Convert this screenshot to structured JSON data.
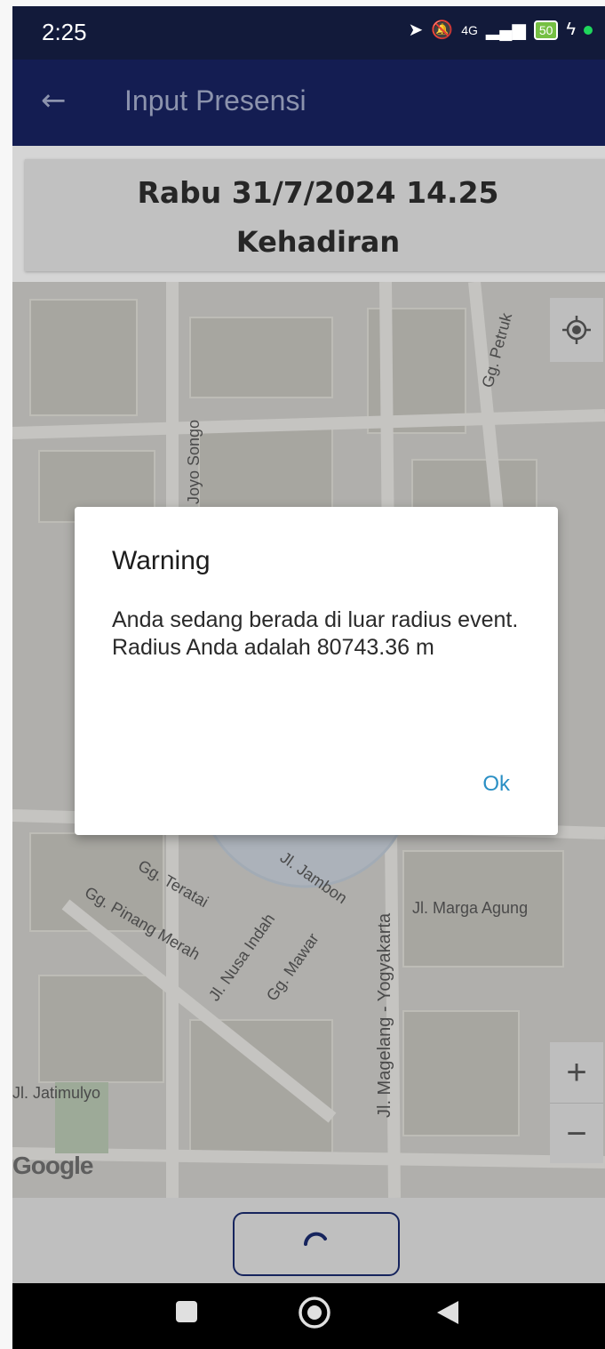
{
  "status_bar": {
    "time": "2:25",
    "network": "4G",
    "battery": "50"
  },
  "app_bar": {
    "title": "Input Presensi",
    "back_icon": "arrow-left-icon"
  },
  "header": {
    "date_time": "Rabu 31/7/2024 14.25",
    "attendance_type": "Kehadiran"
  },
  "map": {
    "labels": {
      "gg_petruk": "Gg. Petruk",
      "joyo_songo": "Joyo Songo",
      "jl_jambon": "Jl. Jambon",
      "gg_teratai": "Gg. Teratai",
      "gg_pinang_merah": "Gg. Pinang Merah",
      "jl_nusa_indah": "Jl. Nusa Indah",
      "gg_mawar": "Gg. Mawar",
      "jl_magelang_yogyakarta": "Jl. Magelang - Yogyakarta",
      "jl_marga_agung": "Jl. Marga Agung",
      "jl_jatimulyo": "Jl. Jatimulyo"
    },
    "attribution": "Google",
    "zoom_in": "+",
    "zoom_out": "−"
  },
  "dialog": {
    "title": "Warning",
    "message": "Anda sedang berada di luar radius event. Radius Anda adalah 80743.36 m",
    "ok_label": "Ok"
  },
  "colors": {
    "app_bar": "#141d52",
    "status_bar": "#121a3a",
    "accent": "#2a8fc4"
  }
}
